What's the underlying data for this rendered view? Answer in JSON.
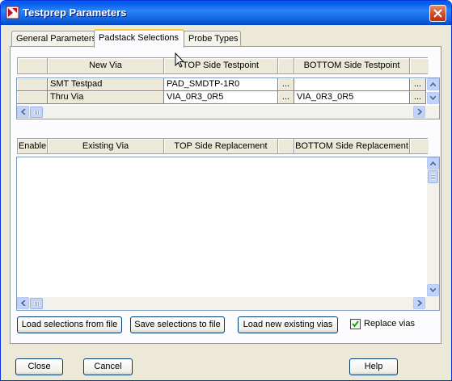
{
  "window": {
    "title": "Testprep Parameters"
  },
  "tabs": [
    {
      "label": "General Parameters"
    },
    {
      "label": "Padstack Selections"
    },
    {
      "label": "Probe Types"
    }
  ],
  "new_via_grid": {
    "headers": [
      "New Via",
      "TOP Side Testpoint",
      "BOTTOM Side Testpoint"
    ],
    "rows": [
      {
        "name": "SMT Testpad",
        "top": "PAD_SMDTP-1R0",
        "top_btn": "...",
        "bottom": "",
        "bottom_btn": "..."
      },
      {
        "name": "Thru Via",
        "top": "VIA_0R3_0R5",
        "top_btn": "...",
        "bottom": "VIA_0R3_0R5",
        "bottom_btn": "..."
      }
    ]
  },
  "existing_via_grid": {
    "headers": [
      "Enable",
      "Existing Via",
      "TOP Side Replacement",
      "BOTTOM Side Replacement"
    ],
    "rows": []
  },
  "actions": {
    "load_selections": "Load selections from file",
    "save_selections": "Save selections to file",
    "load_existing": "Load new existing vias",
    "replace_vias_label": "Replace vias",
    "replace_vias_checked": true
  },
  "footer": {
    "close": "Close",
    "cancel": "Cancel",
    "help": "Help"
  },
  "colors": {
    "title_bar": "#0058ee",
    "tab_highlight": "#ffc83c",
    "dialog_bg": "#ece9d8"
  }
}
